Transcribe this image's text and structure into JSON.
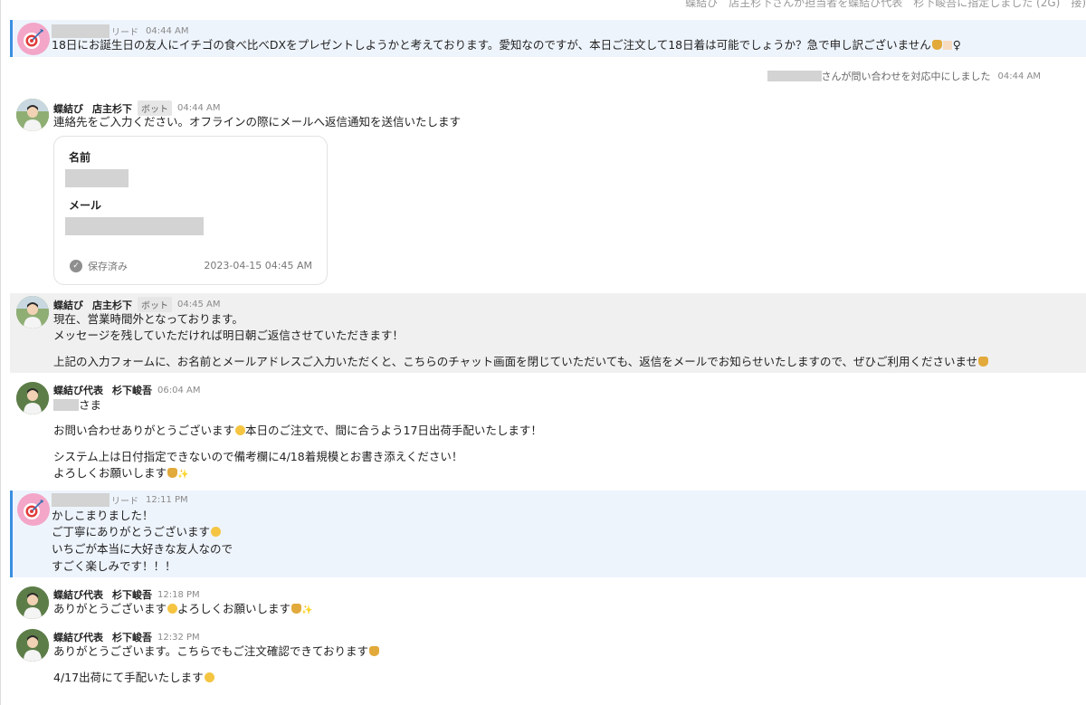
{
  "top_notice": "蝶結び　店主杉下さんが担当者を蝶結び代表　杉下峻吾に指定しました (2G)　接)",
  "lead_label": "リード",
  "bot_label": "ボット",
  "system": {
    "text": "さんが問い合わせを対応中にしました",
    "time": "04:44 AM"
  },
  "contact_form": {
    "name_label": "名前",
    "email_label": "メール",
    "saved_label": "保存済み",
    "saved_time": "2023-04-15 04:45 AM"
  },
  "messages": [
    {
      "sender": "",
      "time": "04:44 AM",
      "lines": [
        "18日にお誕生日の友人にイチゴの食べ比べDXをプレゼントしようかと考えております。愛知なのですが、本日ご注文して18日着は可能でしょうか？急で申し訳ございません",
        "♀"
      ]
    },
    {
      "sender": "蝶結び　店主杉下",
      "time": "04:44 AM",
      "lines": [
        "連絡先をご入力ください。オフラインの際にメールへ返信通知を送信いたします"
      ]
    },
    {
      "sender": "蝶結び　店主杉下",
      "time": "04:45 AM",
      "lines": [
        "現在、営業時間外となっております。",
        "メッセージを残していただければ明日朝ご返信させていただきます！",
        "上記の入力フォームに、お名前とメールアドレスご入力いただくと、こちらのチャット画面を閉じていただいても、返信をメールでお知らせいたしますので、ぜひご利用くださいませ"
      ]
    },
    {
      "sender": "蝶結び代表　杉下峻吾",
      "time": "06:04 AM",
      "lines": [
        "さま",
        "お問い合わせありがとうございます",
        "本日のご注文で、間に合うよう17日出荷手配いたします！",
        "システム上は日付指定できないので備考欄に4/18着規模とお書き添えください！",
        "よろしくお願いします"
      ]
    },
    {
      "sender": "",
      "time": "12:11 PM",
      "lines": [
        "かしこまりました！",
        "ご丁寧にありがとうございます",
        "いちごが本当に大好きな友人なので",
        "すごく楽しみです！！！"
      ]
    },
    {
      "sender": "蝶結び代表　杉下峻吾",
      "time": "12:18 PM",
      "lines": [
        "ありがとうございます",
        "よろしくお願いします"
      ]
    },
    {
      "sender": "蝶結び代表　杉下峻吾",
      "time": "12:32 PM",
      "lines": [
        "ありがとうございます。こちらでもご注文確認できております",
        "4/17出荷にて手配いたします"
      ]
    }
  ]
}
